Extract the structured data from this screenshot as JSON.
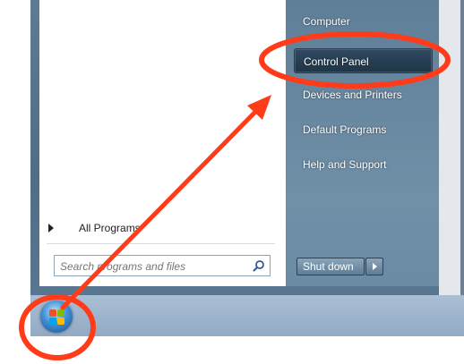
{
  "start_menu": {
    "right_items": [
      "Computer",
      "Control Panel",
      "Devices and Printers",
      "Default Programs",
      "Help and Support"
    ],
    "selected_index": 1,
    "all_programs_label": "All Programs",
    "search": {
      "placeholder": "Search programs and files",
      "icon": "search-icon"
    },
    "shutdown_label": "Shut down"
  },
  "taskbar": {
    "start_button_icon": "windows-logo-icon"
  },
  "annotation": {
    "color": "#ff3b1a",
    "shapes": [
      "circle-around-control-panel",
      "arrow-from-start-to-control-panel",
      "circle-around-start-button"
    ]
  }
}
